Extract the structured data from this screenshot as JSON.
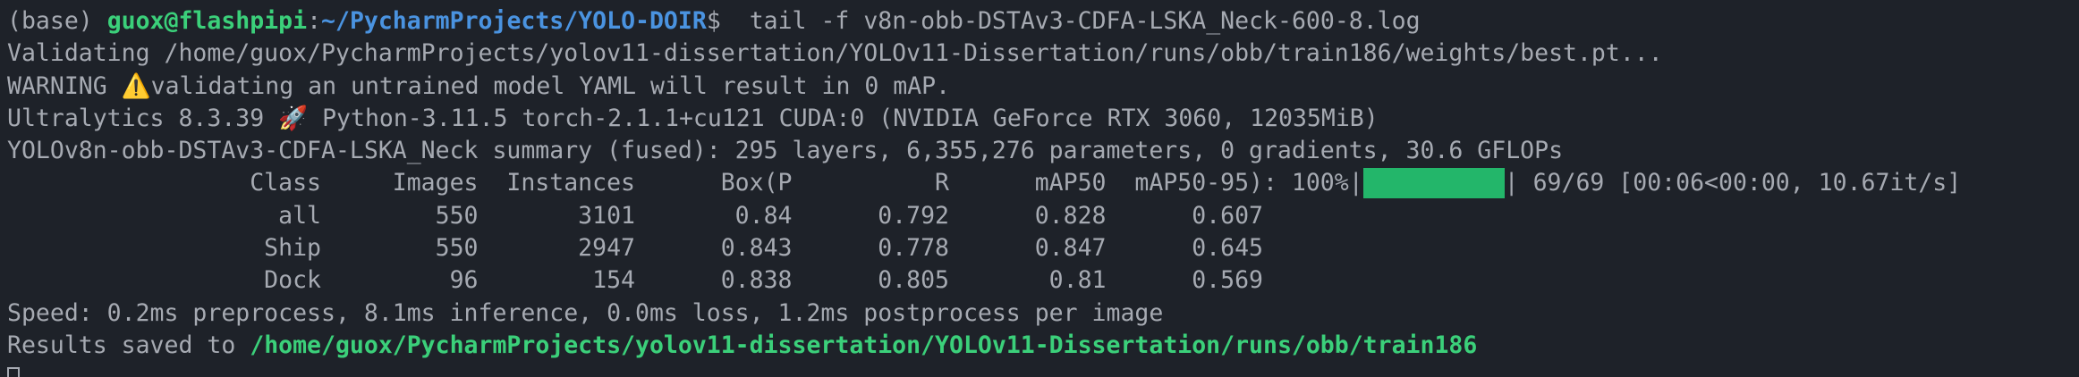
{
  "prompt": {
    "env": "(base) ",
    "user_host": "guox@flashpipi",
    "sep": ":",
    "path": "~/PycharmProjects/YOLO-DOIR",
    "symbol": "$ ",
    "command": " tail -f v8n-obb-DSTAv3-CDFA-LSKA_Neck-600-8.log"
  },
  "log": {
    "validating": "Validating /home/guox/PycharmProjects/yolov11-dissertation/YOLOv11-Dissertation/runs/obb/train186/weights/best.pt...",
    "warning": "WARNING ⚠️validating an untrained model YAML will result in 0 mAP.",
    "env_info": "Ultralytics 8.3.39 🚀 Python-3.11.5 torch-2.1.1+cu121 CUDA:0 (NVIDIA GeForce RTX 3060, 12035MiB)",
    "summary": "YOLOv8n-obb-DSTAv3-CDFA-LSKA_Neck summary (fused): 295 layers, 6,355,276 parameters, 0 gradients, 30.6 GFLOPs",
    "header_text": "                 Class     Images  Instances      Box(P          R      mAP50  mAP50-95): 100%|",
    "progress_fraction": 1.0,
    "progress_text": "| 69/69 [00:06<00:00, 10.67it/s]",
    "rows": [
      "                   all        550       3101       0.84      0.792      0.828      0.607",
      "                  Ship        550       2947      0.843      0.778      0.847      0.645",
      "                  Dock         96        154      0.838      0.805       0.81      0.569"
    ],
    "speed": "Speed: 0.2ms preprocess, 8.1ms inference, 0.0ms loss, 1.2ms postprocess per image",
    "results_prefix": "Results saved to ",
    "results_path": "/home/guox/PycharmProjects/yolov11-dissertation/YOLOv11-Dissertation/runs/obb/train186"
  },
  "colors": {
    "background": "#1e2229",
    "text": "#a6aab2",
    "user_host": "#3bd07a",
    "path": "#4a93e0",
    "progress_bar": "#23b66a"
  }
}
